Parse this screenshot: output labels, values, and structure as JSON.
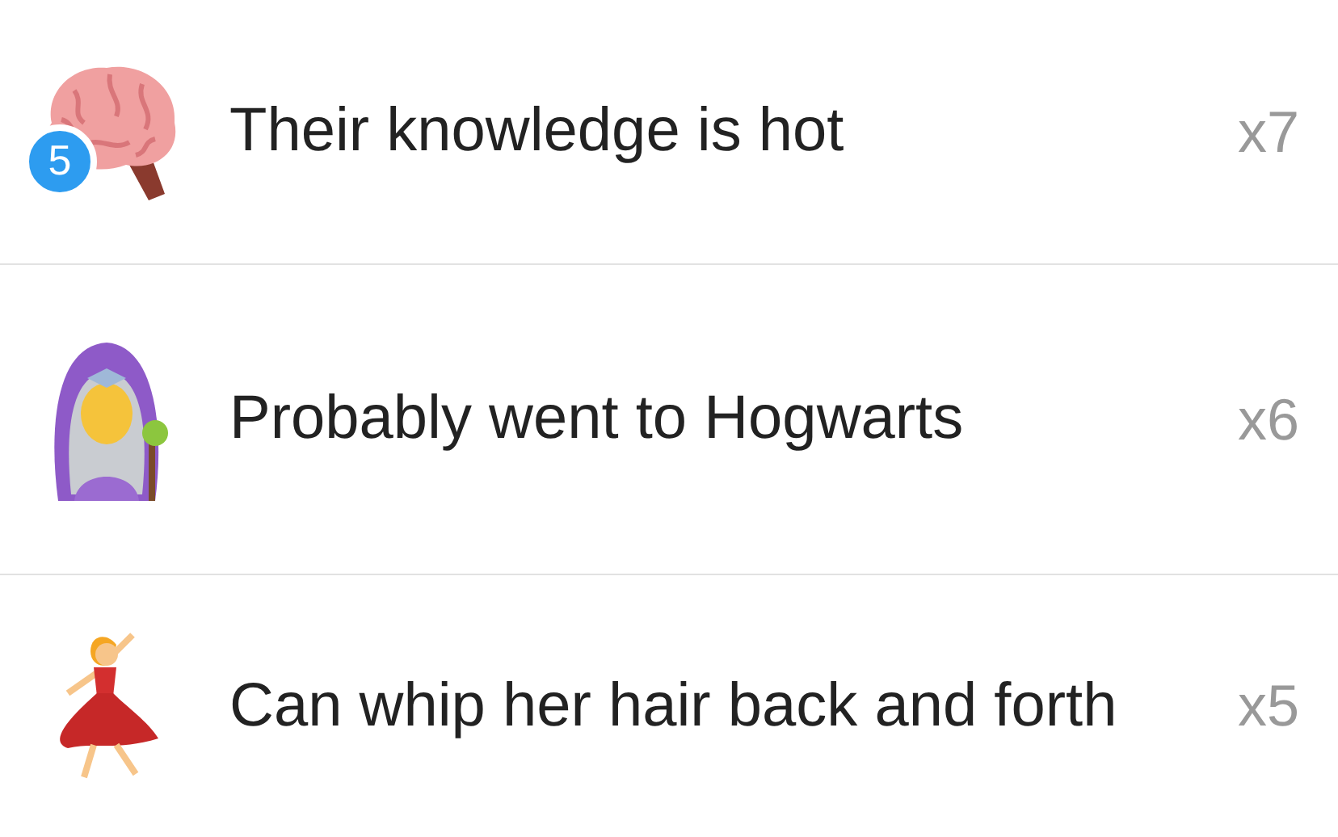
{
  "rows": [
    {
      "kind": "brain",
      "badge": "5",
      "label": "Their knowledge is hot",
      "count": "x7"
    },
    {
      "kind": "mage",
      "label": "Probably went to Hogwarts",
      "count": "x6"
    },
    {
      "kind": "dancer",
      "label": "Can whip her hair back and forth",
      "count": "x5"
    }
  ]
}
